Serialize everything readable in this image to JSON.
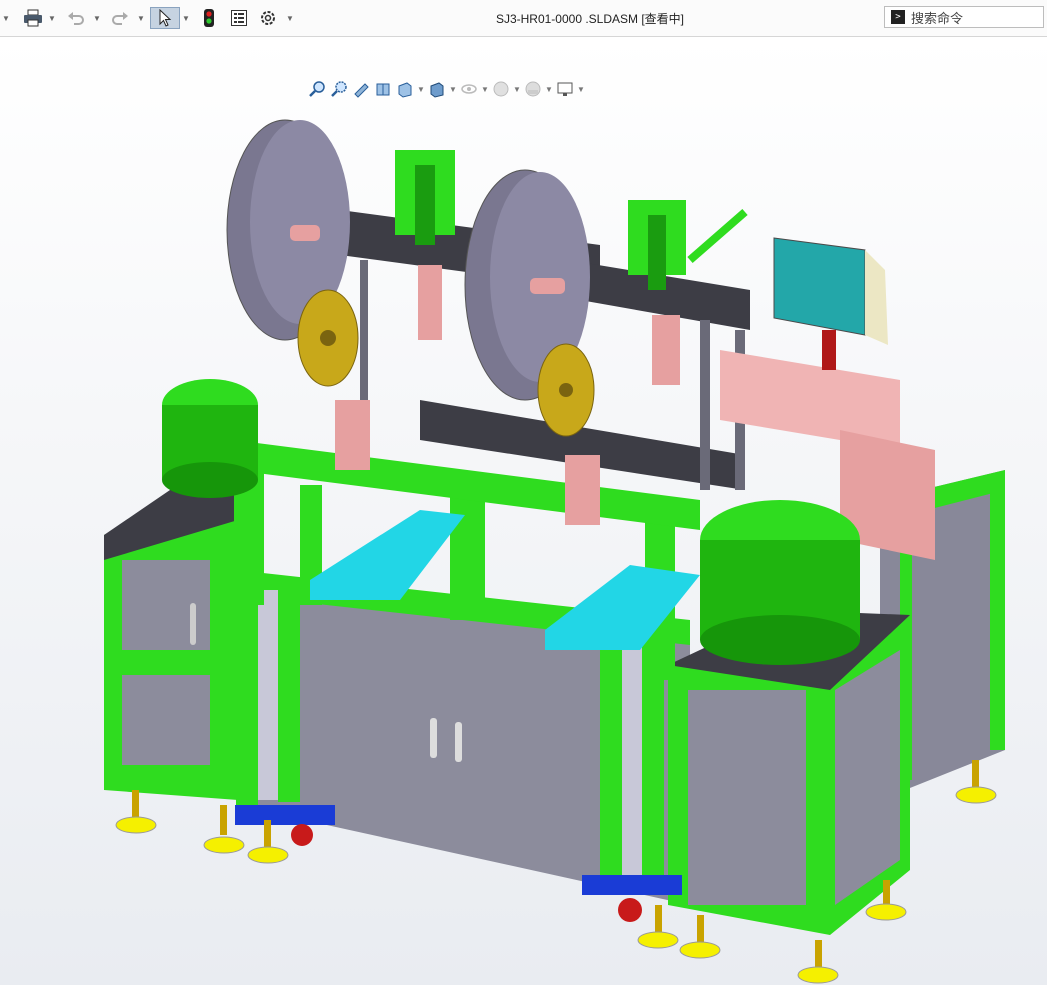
{
  "window": {
    "title": "SJ3-HR01-0000 .SLDASM [查看中]"
  },
  "toolbar": {
    "items": [
      {
        "name": "print-icon"
      },
      {
        "name": "undo-icon"
      },
      {
        "name": "redo-icon"
      },
      {
        "name": "select-icon"
      },
      {
        "name": "rebuild-icon"
      },
      {
        "name": "file-properties-icon"
      },
      {
        "name": "options-icon"
      }
    ]
  },
  "search": {
    "placeholder": "搜索命令"
  },
  "view_toolbar": {
    "items": [
      "zoom-to-fit-icon",
      "zoom-to-area-icon",
      "previous-view-icon",
      "section-view-icon",
      "view-orientation-icon",
      "display-style-icon",
      "hide-show-icon",
      "edit-appearance-icon",
      "apply-scene-icon",
      "view-settings-icon"
    ]
  },
  "colors": {
    "frame_green": "#2fdc1f",
    "panel_gray": "#8c8c9c",
    "dark_plate": "#3d3d45",
    "reel_purple": "#7a7790",
    "reel_gold": "#c8a81a",
    "tray_cyan": "#22d6e6",
    "pink_part": "#e6a0a0",
    "hmi_teal": "#23a7a9",
    "foot_yellow": "#f5f000",
    "caster_blue": "#1a3cd6",
    "caster_red": "#c81a1a"
  }
}
